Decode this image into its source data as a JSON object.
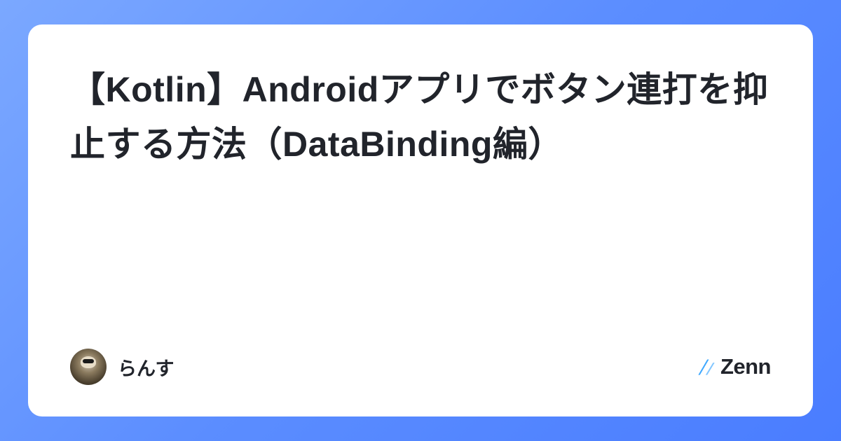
{
  "article": {
    "title": "【Kotlin】Androidアプリでボタン連打を抑止する方法（DataBinding編）"
  },
  "author": {
    "name": "らんす"
  },
  "brand": {
    "name": "Zenn",
    "accent_color": "#3ea8ff"
  }
}
